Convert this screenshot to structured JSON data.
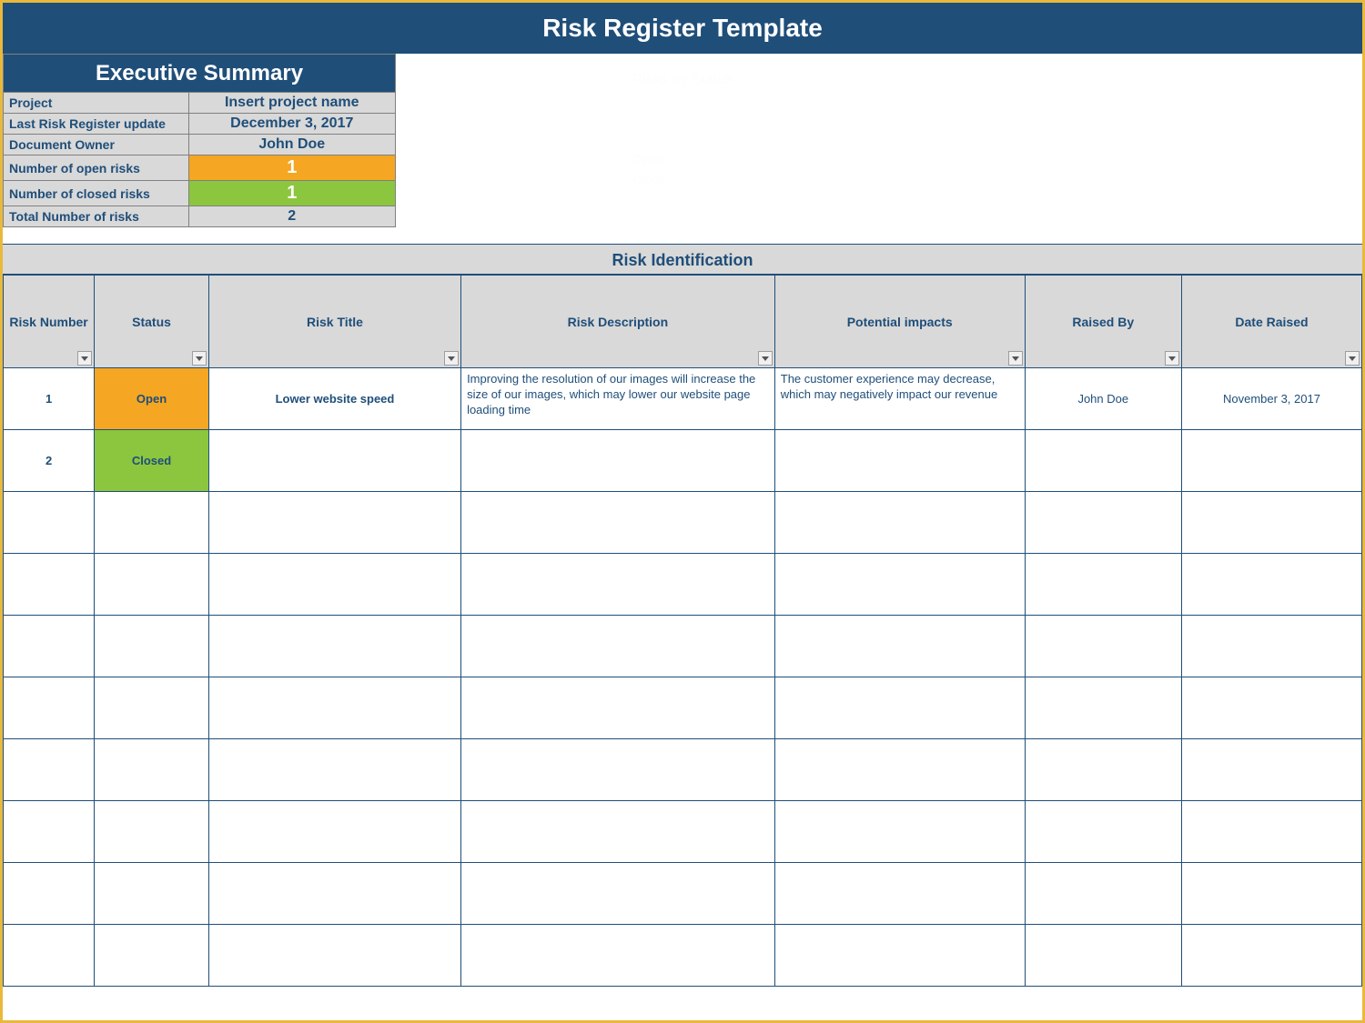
{
  "title": "Risk Register Template",
  "exec_summary": {
    "header": "Executive Summary",
    "rows": {
      "project_label": "Project",
      "project_value": "Insert project name",
      "update_label": "Last Risk Register update",
      "update_value": "December 3, 2017",
      "owner_label": "Document Owner",
      "owner_value": "John Doe",
      "open_label": "Number of open risks",
      "open_value": "1",
      "closed_label": "Number of closed risks",
      "closed_value": "1",
      "total_label": "Total Number of risks",
      "total_value": "2"
    }
  },
  "chart_ghost": {
    "title": "Risks by Status",
    "legend_open": "Open",
    "legend_closed": "Closed"
  },
  "risk_section_header": "Risk Identification",
  "columns": {
    "num": "Risk Number",
    "status": "Status",
    "title": "Risk Title",
    "desc": "Risk Description",
    "impact": "Potential impacts",
    "raised_by": "Raised By",
    "date": "Date Raised"
  },
  "rows": [
    {
      "num": "1",
      "status": "Open",
      "status_class": "status-open",
      "title": "Lower website speed",
      "desc": "Improving the resolution of our images will increase the size of our images, which may lower our website page loading time",
      "impact": "The customer experience may decrease, which may negatively impact our revenue",
      "raised_by": "John Doe",
      "date": "November 3, 2017"
    },
    {
      "num": "2",
      "status": "Closed",
      "status_class": "status-closed",
      "title": "",
      "desc": "",
      "impact": "",
      "raised_by": "",
      "date": ""
    },
    {
      "num": "",
      "status": "",
      "status_class": "",
      "title": "",
      "desc": "",
      "impact": "",
      "raised_by": "",
      "date": ""
    },
    {
      "num": "",
      "status": "",
      "status_class": "",
      "title": "",
      "desc": "",
      "impact": "",
      "raised_by": "",
      "date": ""
    },
    {
      "num": "",
      "status": "",
      "status_class": "",
      "title": "",
      "desc": "",
      "impact": "",
      "raised_by": "",
      "date": ""
    },
    {
      "num": "",
      "status": "",
      "status_class": "",
      "title": "",
      "desc": "",
      "impact": "",
      "raised_by": "",
      "date": ""
    },
    {
      "num": "",
      "status": "",
      "status_class": "",
      "title": "",
      "desc": "",
      "impact": "",
      "raised_by": "",
      "date": ""
    },
    {
      "num": "",
      "status": "",
      "status_class": "",
      "title": "",
      "desc": "",
      "impact": "",
      "raised_by": "",
      "date": ""
    },
    {
      "num": "",
      "status": "",
      "status_class": "",
      "title": "",
      "desc": "",
      "impact": "",
      "raised_by": "",
      "date": ""
    },
    {
      "num": "",
      "status": "",
      "status_class": "",
      "title": "",
      "desc": "",
      "impact": "",
      "raised_by": "",
      "date": ""
    }
  ],
  "chart_data": {
    "type": "pie",
    "title": "Risks by Status",
    "categories": [
      "Open",
      "Closed"
    ],
    "values": [
      1,
      1
    ]
  }
}
